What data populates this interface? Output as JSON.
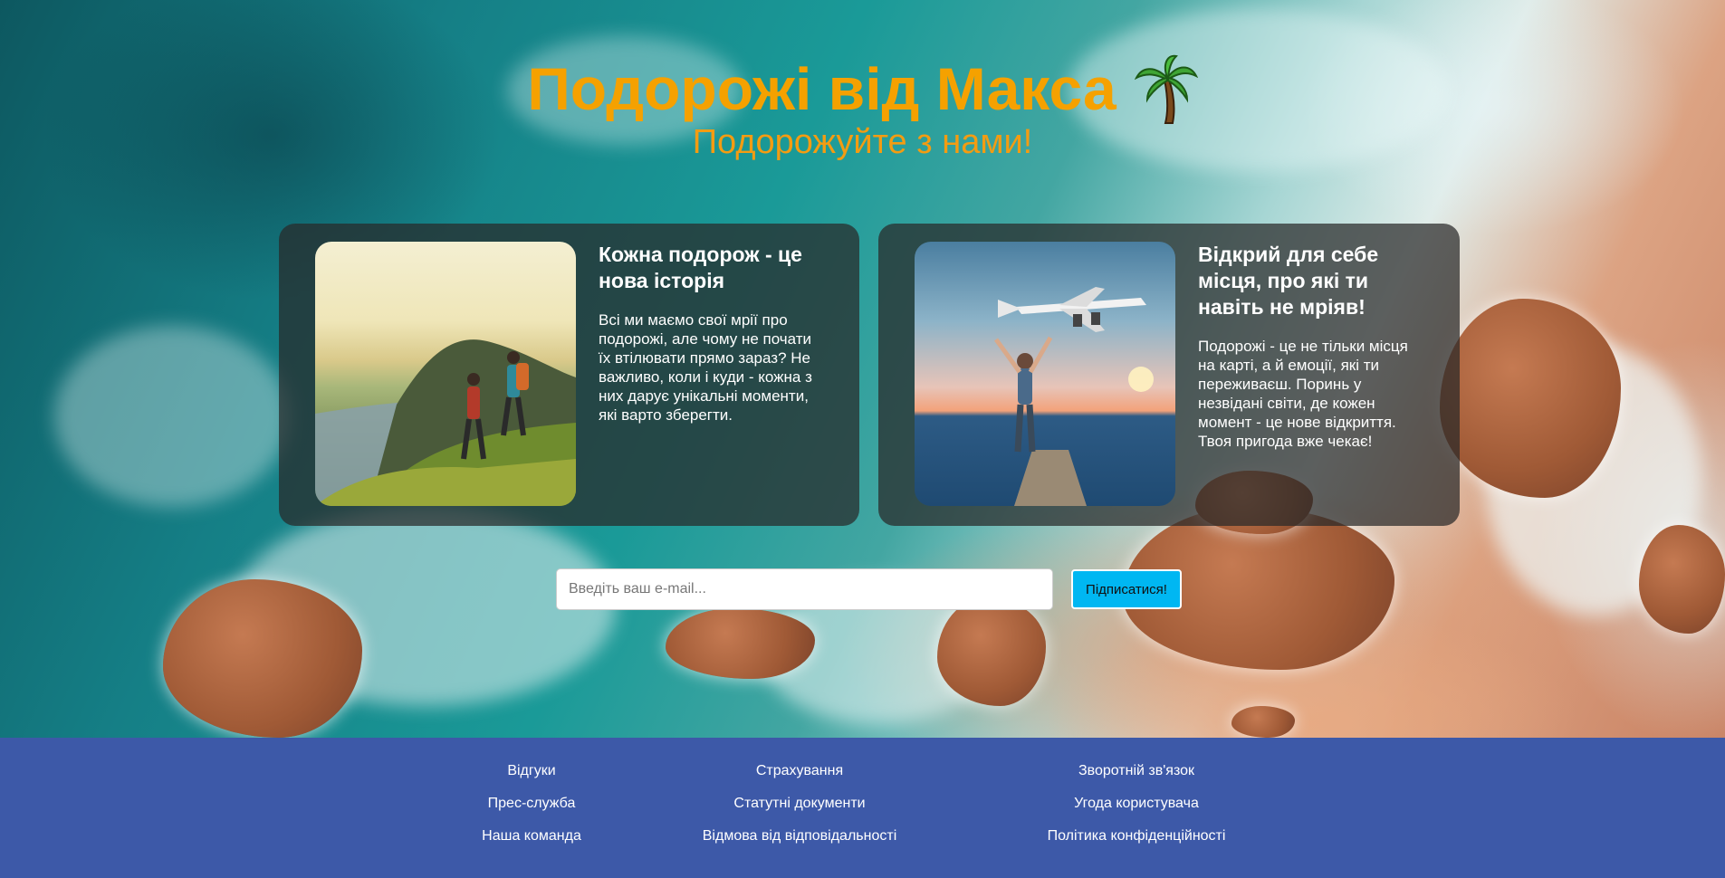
{
  "header": {
    "title": "Подорожі від Макса",
    "title_icon": "palm-tree-icon",
    "subtitle": "Подорожуйте з нами!",
    "title_color": "#f5a100",
    "subtitle_color": "#f39c12"
  },
  "cards": [
    {
      "title": "Кожна подорож - це нова історія",
      "text": "Всі ми маємо свої мрії про подорожі, але чому не почати їх втілювати прямо зараз? Не важливо, коли і куди - кожна з них дарує унікальні моменти, які варто зберегти.",
      "image": "hikers-on-cliff-photo"
    },
    {
      "title": "Відкрий для себе місця, про які ти навіть не мріяв!",
      "text": "Подорожі - це не тільки місця на карті, а й емоції, які ти переживаєш. Поринь у незвідані світи, де кожен момент - це нове відкриття. Твоя пригода вже чекає!",
      "image": "woman-and-airplane-at-sunset-photo"
    }
  ],
  "subscribe": {
    "placeholder": "Введіть ваш e-mail...",
    "value": "",
    "button_label": "Підписатися!",
    "button_color": "#00b7f2"
  },
  "footer": {
    "background": "#3d59a8",
    "columns": [
      [
        "Відгуки",
        "Прес-служба",
        "Наша команда"
      ],
      [
        "Страхування",
        "Статутні документи",
        "Відмова від відповідальності"
      ],
      [
        "Зворотній зв'язок",
        "Угода користувача",
        "Політика конфіденційності"
      ]
    ]
  }
}
